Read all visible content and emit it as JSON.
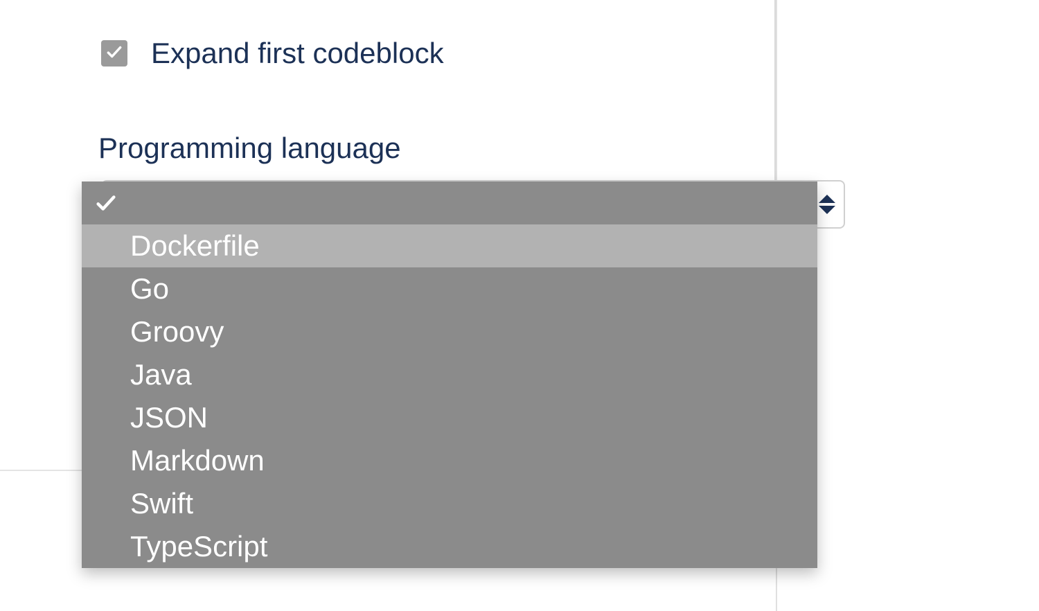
{
  "form": {
    "expand_checkbox": {
      "label": "Expand first codeblock",
      "checked": true
    },
    "language_field": {
      "label": "Programming language",
      "selected_value": "",
      "options": [
        {
          "label": "",
          "selected": true,
          "highlighted": false
        },
        {
          "label": "Dockerfile",
          "selected": false,
          "highlighted": true
        },
        {
          "label": "Go",
          "selected": false,
          "highlighted": false
        },
        {
          "label": "Groovy",
          "selected": false,
          "highlighted": false
        },
        {
          "label": "Java",
          "selected": false,
          "highlighted": false
        },
        {
          "label": "JSON",
          "selected": false,
          "highlighted": false
        },
        {
          "label": "Markdown",
          "selected": false,
          "highlighted": false
        },
        {
          "label": "Swift",
          "selected": false,
          "highlighted": false
        },
        {
          "label": "TypeScript",
          "selected": false,
          "highlighted": false
        }
      ]
    }
  }
}
